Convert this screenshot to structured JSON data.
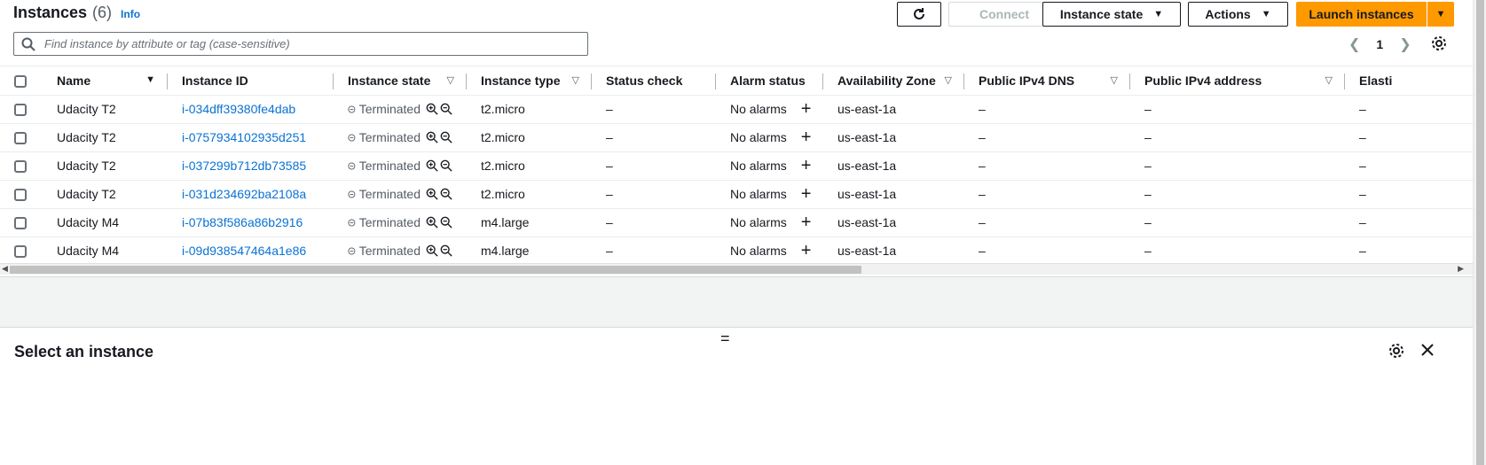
{
  "header": {
    "title": "Instances",
    "count": "(6)",
    "info": "Info",
    "connect": "Connect",
    "instance_state": "Instance state",
    "actions": "Actions",
    "launch": "Launch instances"
  },
  "search": {
    "placeholder": "Find instance by attribute or tag (case-sensitive)"
  },
  "pagination": {
    "page": "1"
  },
  "columns": [
    "Name",
    "Instance ID",
    "Instance state",
    "Instance type",
    "Status check",
    "Alarm status",
    "Availability Zone",
    "Public IPv4 DNS",
    "Public IPv4 address",
    "Elasti"
  ],
  "rows": [
    {
      "name": "Udacity T2",
      "id": "i-034dff39380fe4dab",
      "state": "Terminated",
      "type": "t2.micro",
      "status": "–",
      "alarm": "No alarms",
      "az": "us-east-1a",
      "dns": "–",
      "ip": "–",
      "elastic": "–"
    },
    {
      "name": "Udacity T2",
      "id": "i-0757934102935d251",
      "state": "Terminated",
      "type": "t2.micro",
      "status": "–",
      "alarm": "No alarms",
      "az": "us-east-1a",
      "dns": "–",
      "ip": "–",
      "elastic": "–"
    },
    {
      "name": "Udacity T2",
      "id": "i-037299b712db73585",
      "state": "Terminated",
      "type": "t2.micro",
      "status": "–",
      "alarm": "No alarms",
      "az": "us-east-1a",
      "dns": "–",
      "ip": "–",
      "elastic": "–"
    },
    {
      "name": "Udacity T2",
      "id": "i-031d234692ba2108a",
      "state": "Terminated",
      "type": "t2.micro",
      "status": "–",
      "alarm": "No alarms",
      "az": "us-east-1a",
      "dns": "–",
      "ip": "–",
      "elastic": "–"
    },
    {
      "name": "Udacity M4",
      "id": "i-07b83f586a86b2916",
      "state": "Terminated",
      "type": "m4.large",
      "status": "–",
      "alarm": "No alarms",
      "az": "us-east-1a",
      "dns": "–",
      "ip": "–",
      "elastic": "–"
    },
    {
      "name": "Udacity M4",
      "id": "i-09d938547464a1e86",
      "state": "Terminated",
      "type": "m4.large",
      "status": "–",
      "alarm": "No alarms",
      "az": "us-east-1a",
      "dns": "–",
      "ip": "–",
      "elastic": "–"
    }
  ],
  "panel": {
    "title": "Select an instance"
  },
  "colors": {
    "accent": "#ff9900",
    "link": "#0972d3",
    "text": "#16191f"
  }
}
